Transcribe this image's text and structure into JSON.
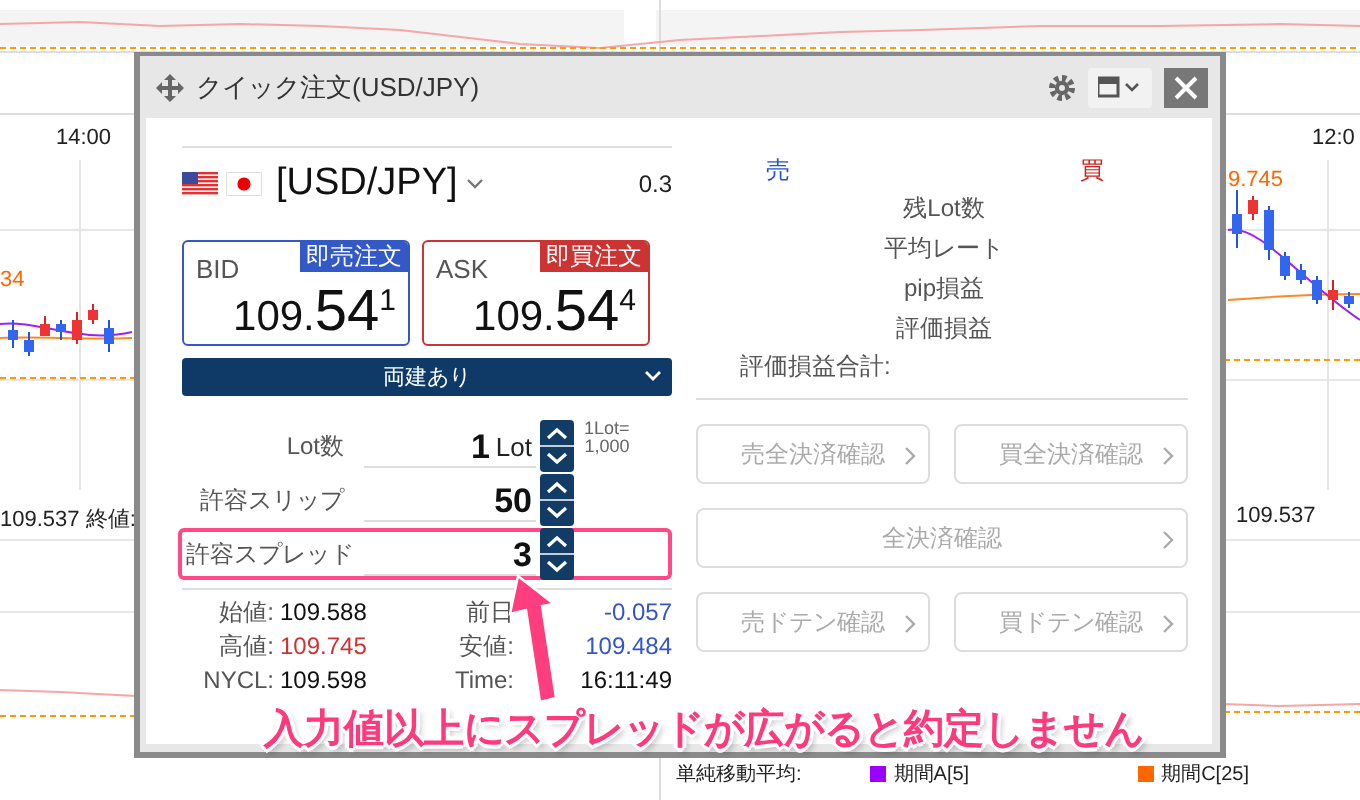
{
  "background": {
    "left_chart": {
      "time_label": "14:00",
      "price_label": "34",
      "close_info": "109.537 終値:"
    },
    "right_chart": {
      "time_label": "12:0",
      "price_label": "9.745",
      "close_info": "109.537"
    },
    "legend": {
      "title": "単純移動平均:",
      "items": [
        {
          "label": "期間A[5]",
          "color": "#9900ff"
        },
        {
          "label": "期間C[25]",
          "color": "#ff6600"
        }
      ]
    }
  },
  "window": {
    "title": "クイック注文(USD/JPY)"
  },
  "pair": {
    "name": "[USD/JPY]",
    "spread": "0.3"
  },
  "quotes": [
    {
      "kind": "bid",
      "label": "BID",
      "action": "即売注文",
      "head": "109.",
      "main": "54",
      "tail": "1"
    },
    {
      "kind": "ask",
      "label": "ASK",
      "action": "即買注文",
      "head": "109.",
      "main": "54",
      "tail": "4"
    }
  ],
  "position_mode": "両建あり",
  "inputs": [
    {
      "label": "Lot数",
      "value": "1",
      "unit": "Lot",
      "note": "1Lot=",
      "note_value": "1,000",
      "highlighted": false
    },
    {
      "label": "許容スリップ",
      "value": "50",
      "highlighted": false
    },
    {
      "label": "許容スプレッド",
      "value": "3",
      "highlighted": true
    }
  ],
  "stats": [
    {
      "label": "始値:",
      "value": "109.588",
      "color": "#111111"
    },
    {
      "label": "前日",
      "value": "-0.057",
      "color": "#3355cc"
    },
    {
      "label": "高値:",
      "value": "109.745",
      "color": "#cc3333"
    },
    {
      "label": "安値:",
      "value": "109.484",
      "color": "#3355cc"
    },
    {
      "label": "NYCL:",
      "value": "109.598",
      "color": "#111111"
    },
    {
      "label": "Time:",
      "value": "16:11:49",
      "color": "#111111"
    }
  ],
  "positions": {
    "sell_heading": "売",
    "buy_heading": "買",
    "rows": [
      "残Lot数",
      "平均レート",
      "pip損益",
      "評価損益"
    ],
    "total_label": "評価損益合計:"
  },
  "buttons": [
    [
      {
        "label": "売全決済確認",
        "disabled": true
      },
      {
        "label": "買全決済確認",
        "disabled": true
      }
    ],
    [
      {
        "label": "全決済確認",
        "disabled": true
      }
    ],
    [
      {
        "label": "売ドテン確認",
        "disabled": true
      },
      {
        "label": "買ドテン確認",
        "disabled": true
      }
    ]
  ],
  "annotation": {
    "caption": "入力値以上にスプレッドが広がると約定しません"
  }
}
